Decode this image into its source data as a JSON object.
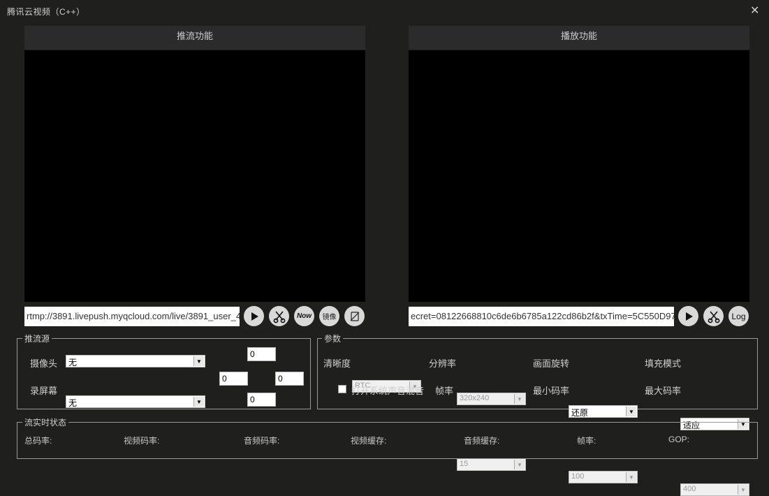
{
  "window": {
    "title": "腾讯云视频（C++）"
  },
  "push": {
    "header": "推流功能",
    "url": "rtmp://3891.livepush.myqcloud.com/live/3891_user_4",
    "buttons": {
      "now_label": "Now",
      "mirror_label": "镜像"
    }
  },
  "play": {
    "header": "播放功能",
    "url": "ecret=08122668810c6de6b6785a122cd86b2f&txTime=5C550D97",
    "buttons": {
      "log_label": "Log"
    }
  },
  "source": {
    "legend": "推流源",
    "camera_label": "摄像头",
    "camera_value": "无",
    "screen_label": "录屏幕",
    "screen_value": "无",
    "top": "0",
    "left": "0",
    "right": "0",
    "bottom": "0"
  },
  "params": {
    "legend": "参数",
    "quality_label": "清晰度",
    "quality_value": "RTC",
    "resolution_label": "分辨率",
    "resolution_value": "320x240",
    "rotation_label": "画面旋转",
    "rotation_value": "还原",
    "fill_label": "填充模式",
    "fill_value": "适应",
    "mix_label": "打开系统声音混音",
    "fps_label": "帧率",
    "fps_value": "15",
    "min_bitrate_label": "最小码率",
    "min_bitrate_value": "100",
    "max_bitrate_label": "最大码率",
    "max_bitrate_value": "400"
  },
  "status": {
    "legend": "流实时状态",
    "total_bitrate": "总码率:",
    "video_bitrate": "视频码率:",
    "audio_bitrate": "音频码率:",
    "video_cache": "视频缓存:",
    "audio_cache": "音频缓存:",
    "fps": "帧率:",
    "gop": "GOP:"
  },
  "icons": [
    "play-icon",
    "scissors-icon",
    "now-icon",
    "mirror-icon",
    "rotate-icon",
    "log-icon",
    "close-icon"
  ]
}
